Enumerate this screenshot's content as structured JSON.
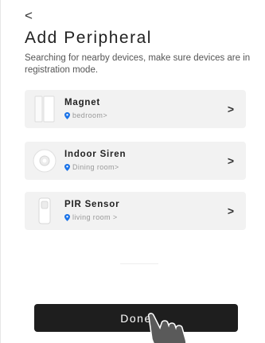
{
  "header": {
    "back_glyph": "<",
    "title": "Add Peripheral",
    "subtitle": "Searching for nearby devices, make sure devices are in registration mode."
  },
  "devices": [
    {
      "name": "Magnet",
      "location": "bedroom>",
      "icon": "magnet-sensor-icon"
    },
    {
      "name": "Indoor Siren",
      "location": "Dining room>",
      "icon": "siren-icon"
    },
    {
      "name": "PIR Sensor",
      "location": "living room >",
      "icon": "pir-sensor-icon"
    }
  ],
  "chevron": ">",
  "footer": {
    "done_label": "Done"
  },
  "colors": {
    "pin": "#1a73e8",
    "button": "#1e1e1e",
    "card": "#f2f2f2"
  }
}
